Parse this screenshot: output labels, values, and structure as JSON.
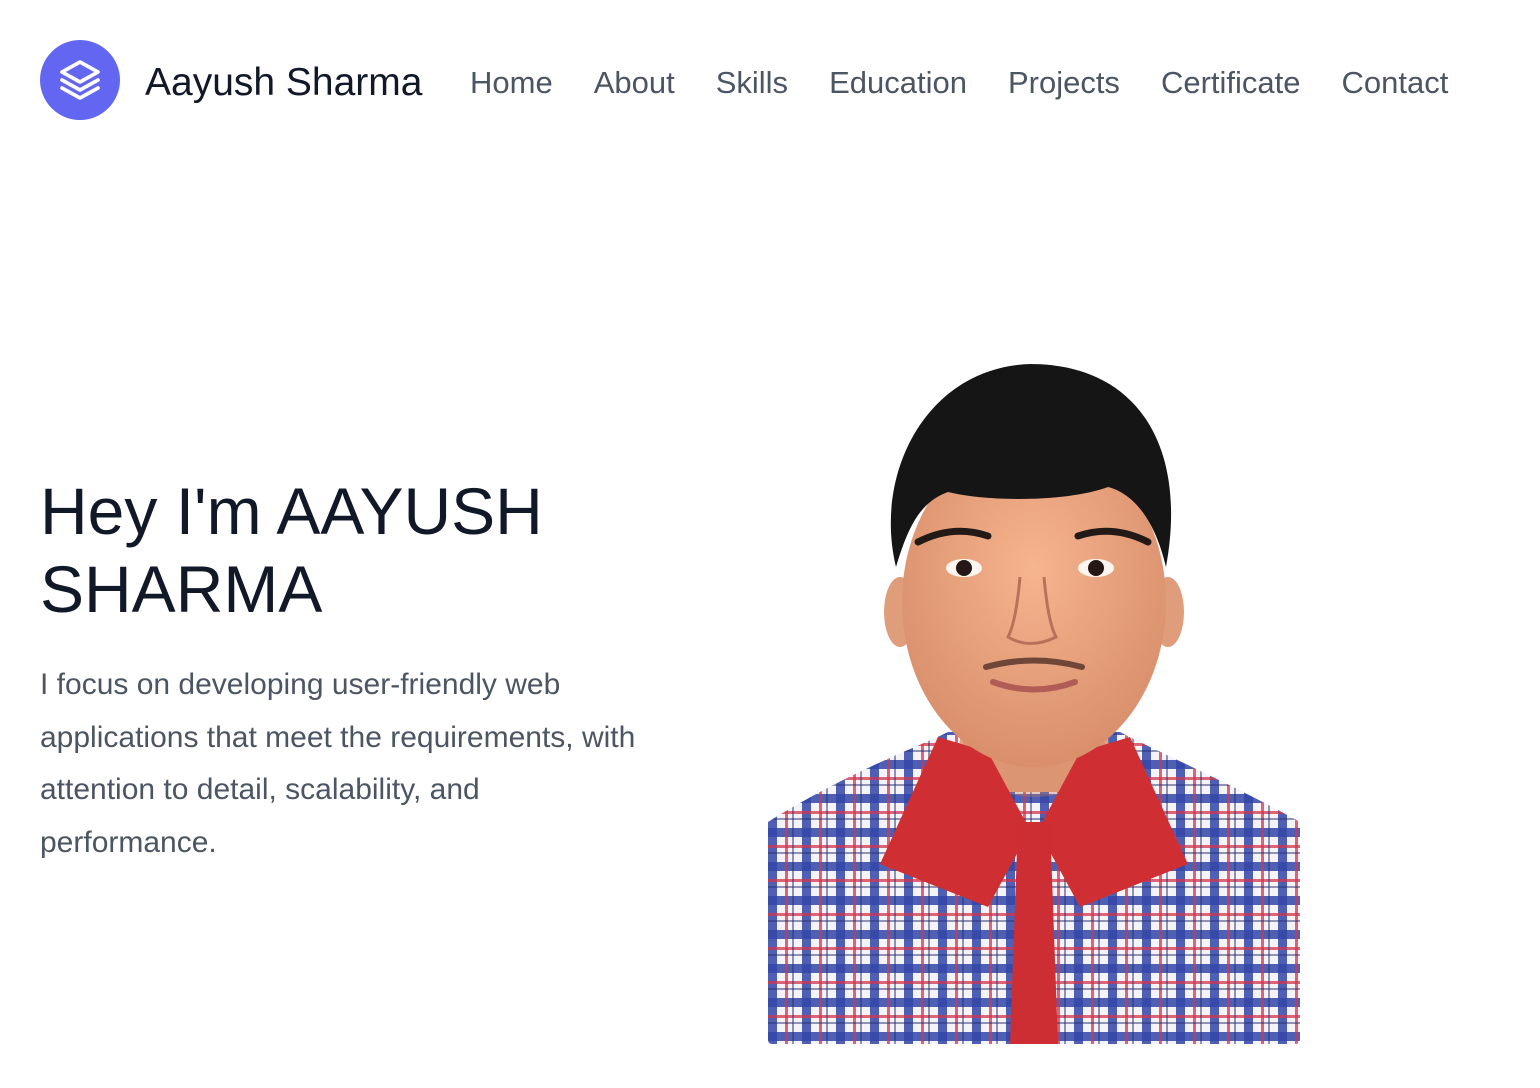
{
  "brand": {
    "name": "Aayush Sharma",
    "logo_icon": "stacked-layers-icon",
    "logo_color": "#6366f1"
  },
  "nav": {
    "items": [
      {
        "label": "Home"
      },
      {
        "label": "About"
      },
      {
        "label": "Skills"
      },
      {
        "label": "Education"
      },
      {
        "label": "Projects"
      },
      {
        "label": "Certificate"
      },
      {
        "label": "Contact"
      }
    ]
  },
  "hero": {
    "title": "Hey I'm AAYUSH SHARMA",
    "description": "I focus on developing user-friendly web applications that meet the requirements, with attention to detail, scalability, and performance."
  },
  "portrait": {
    "icon": "profile-photo"
  },
  "colors": {
    "text_primary": "#111827",
    "text_secondary": "#4b5563",
    "accent": "#6366f1"
  }
}
